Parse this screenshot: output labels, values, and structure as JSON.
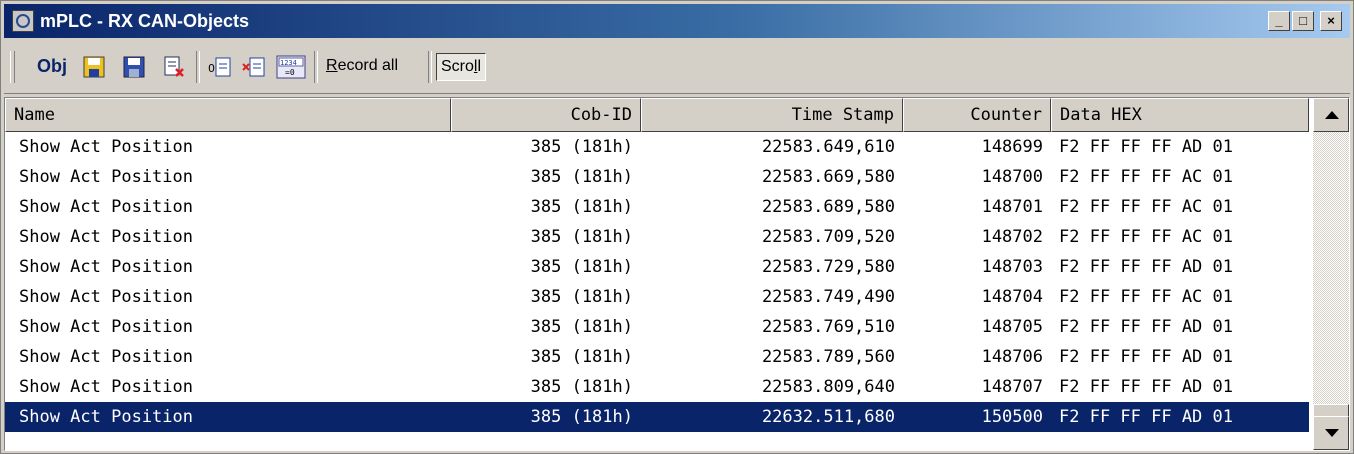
{
  "window": {
    "title": "mPLC - RX CAN-Objects",
    "minimize_symbol": "_",
    "maximize_symbol": "□",
    "close_symbol": "×"
  },
  "toolbar": {
    "obj_label": "Obj",
    "record_all_prefix": "R",
    "record_all_rest": "ecord all",
    "scroll_prefix": "Scro",
    "scroll_underline": "l",
    "scroll_suffix": "l",
    "icons": [
      "save-icon",
      "save-as-icon",
      "delete-file-icon",
      "reset-icon",
      "clear-icon",
      "counter-reset-icon"
    ]
  },
  "table": {
    "columns": [
      "Name",
      "Cob-ID",
      "Time Stamp",
      "Counter",
      "Data HEX"
    ],
    "rows": [
      {
        "name": "Show Act Position",
        "cob": "385 (181h)",
        "time": "22583.649,610",
        "counter": "148699",
        "data": "F2 FF FF FF AD 01"
      },
      {
        "name": "Show Act Position",
        "cob": "385 (181h)",
        "time": "22583.669,580",
        "counter": "148700",
        "data": "F2 FF FF FF AC 01"
      },
      {
        "name": "Show Act Position",
        "cob": "385 (181h)",
        "time": "22583.689,580",
        "counter": "148701",
        "data": "F2 FF FF FF AC 01"
      },
      {
        "name": "Show Act Position",
        "cob": "385 (181h)",
        "time": "22583.709,520",
        "counter": "148702",
        "data": "F2 FF FF FF AC 01"
      },
      {
        "name": "Show Act Position",
        "cob": "385 (181h)",
        "time": "22583.729,580",
        "counter": "148703",
        "data": "F2 FF FF FF AD 01"
      },
      {
        "name": "Show Act Position",
        "cob": "385 (181h)",
        "time": "22583.749,490",
        "counter": "148704",
        "data": "F2 FF FF FF AC 01"
      },
      {
        "name": "Show Act Position",
        "cob": "385 (181h)",
        "time": "22583.769,510",
        "counter": "148705",
        "data": "F2 FF FF FF AD 01"
      },
      {
        "name": "Show Act Position",
        "cob": "385 (181h)",
        "time": "22583.789,560",
        "counter": "148706",
        "data": "F2 FF FF FF AD 01"
      },
      {
        "name": "Show Act Position",
        "cob": "385 (181h)",
        "time": "22583.809,640",
        "counter": "148707",
        "data": "F2 FF FF FF AD 01"
      },
      {
        "name": "Show Act Position",
        "cob": "385 (181h)",
        "time": "22632.511,680",
        "counter": "150500",
        "data": "F2 FF FF FF AD 01"
      }
    ],
    "selected_row": 9
  },
  "colors": {
    "titlebar_start": "#0a246a",
    "titlebar_end": "#a6caf0",
    "selection": "#0a246a",
    "face": "#d4d0c8"
  }
}
